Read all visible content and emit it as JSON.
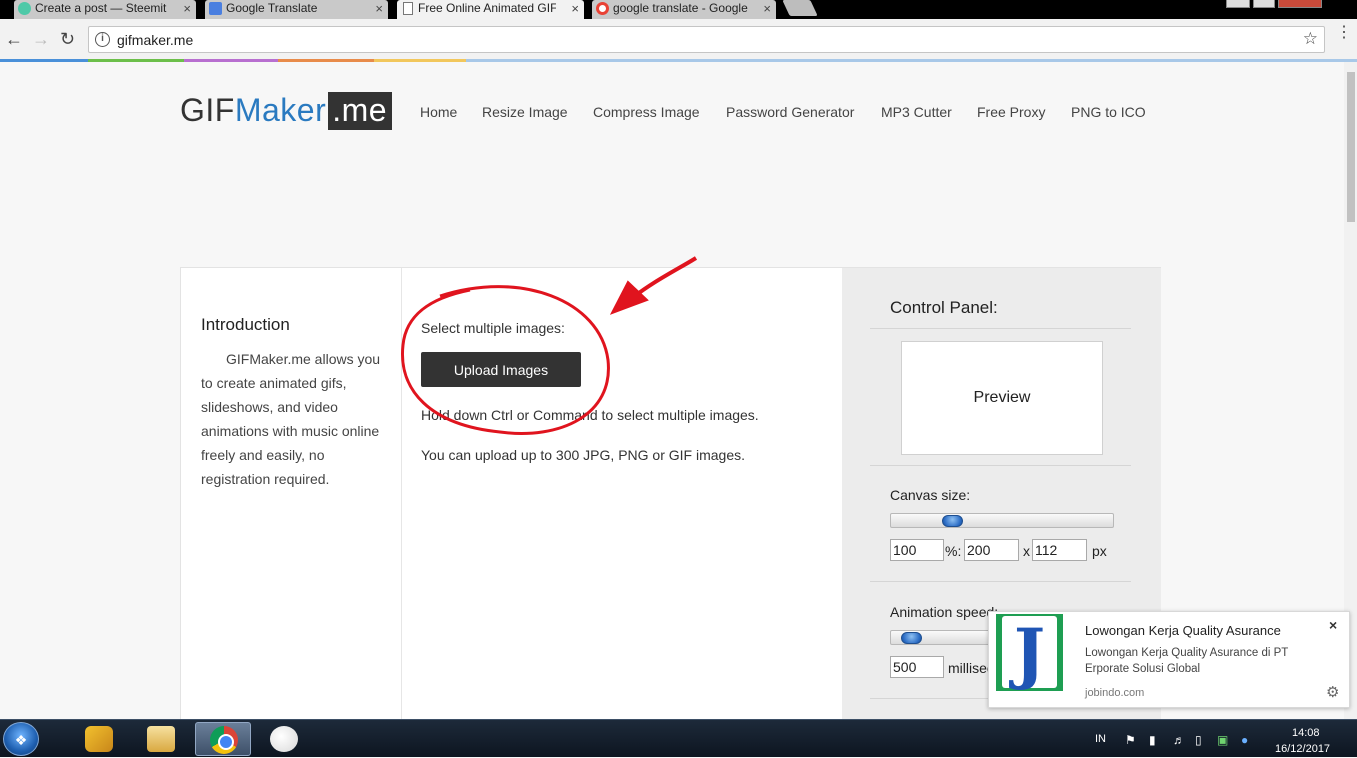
{
  "browser": {
    "tabs": [
      {
        "title": "Create a post — Steemit",
        "favicon": "steemit-icon",
        "favicon_color": "#4ec9a8"
      },
      {
        "title": "Google Translate",
        "favicon": "google-translate-icon",
        "favicon_color": "#4a7fe0"
      },
      {
        "title": "Free Online Animated GIF",
        "favicon": "document-icon",
        "favicon_color": "#ffffff"
      },
      {
        "title": "google translate - Google",
        "favicon": "google-icon",
        "favicon_color": "#e94235"
      }
    ],
    "tab_close_glyph": "×",
    "address": "gifmaker.me",
    "accent_stripe": [
      "#4a90d9",
      "#6cbf4a",
      "#b86fd0",
      "#e88b4a",
      "#f2c75c",
      "#a8c8e8"
    ]
  },
  "site": {
    "logo": {
      "part1": "GIF",
      "part2": "Maker",
      "part3": ".me"
    },
    "nav": [
      "Home",
      "Resize Image",
      "Compress Image",
      "Password Generator",
      "MP3 Cutter",
      "Free Proxy",
      "PNG to ICO"
    ]
  },
  "intro": {
    "title": "Introduction",
    "text": "GIFMaker.me allows you to create animated gifs, slideshows, and video animations with music online freely and easily, no registration required."
  },
  "upload": {
    "select_label": "Select multiple images:",
    "button_label": "Upload Images",
    "hint": "Hold down Ctrl or Command to select multiple images.",
    "limit": "You can upload up to 300 JPG, PNG or GIF images."
  },
  "control_panel": {
    "title": "Control Panel:",
    "preview_label": "Preview",
    "canvas_label": "Canvas size:",
    "canvas_percent": "100",
    "canvas_percent_unit": "%:",
    "canvas_width": "200",
    "canvas_x": "x",
    "canvas_height": "112",
    "canvas_unit": "px",
    "speed_label": "Animation speed:",
    "speed_value": "500",
    "speed_unit": "milliseconds"
  },
  "annotation": {
    "color": "#e0141e"
  },
  "notification": {
    "title": "Lowongan Kerja Quality Asurance",
    "body": "Lowongan Kerja Quality Asurance di PT Erporate Solusi Global",
    "source": "jobindo.com",
    "logo_letter": "J",
    "close": "×",
    "settings_icon": "gear-icon"
  },
  "taskbar": {
    "start_icon": "windows-start-icon",
    "apps": [
      "bug-shield-app-icon",
      "file-explorer-icon",
      "chrome-icon",
      "paint-icon"
    ],
    "language": "IN",
    "time": "14:08",
    "date": "16/12/2017"
  }
}
